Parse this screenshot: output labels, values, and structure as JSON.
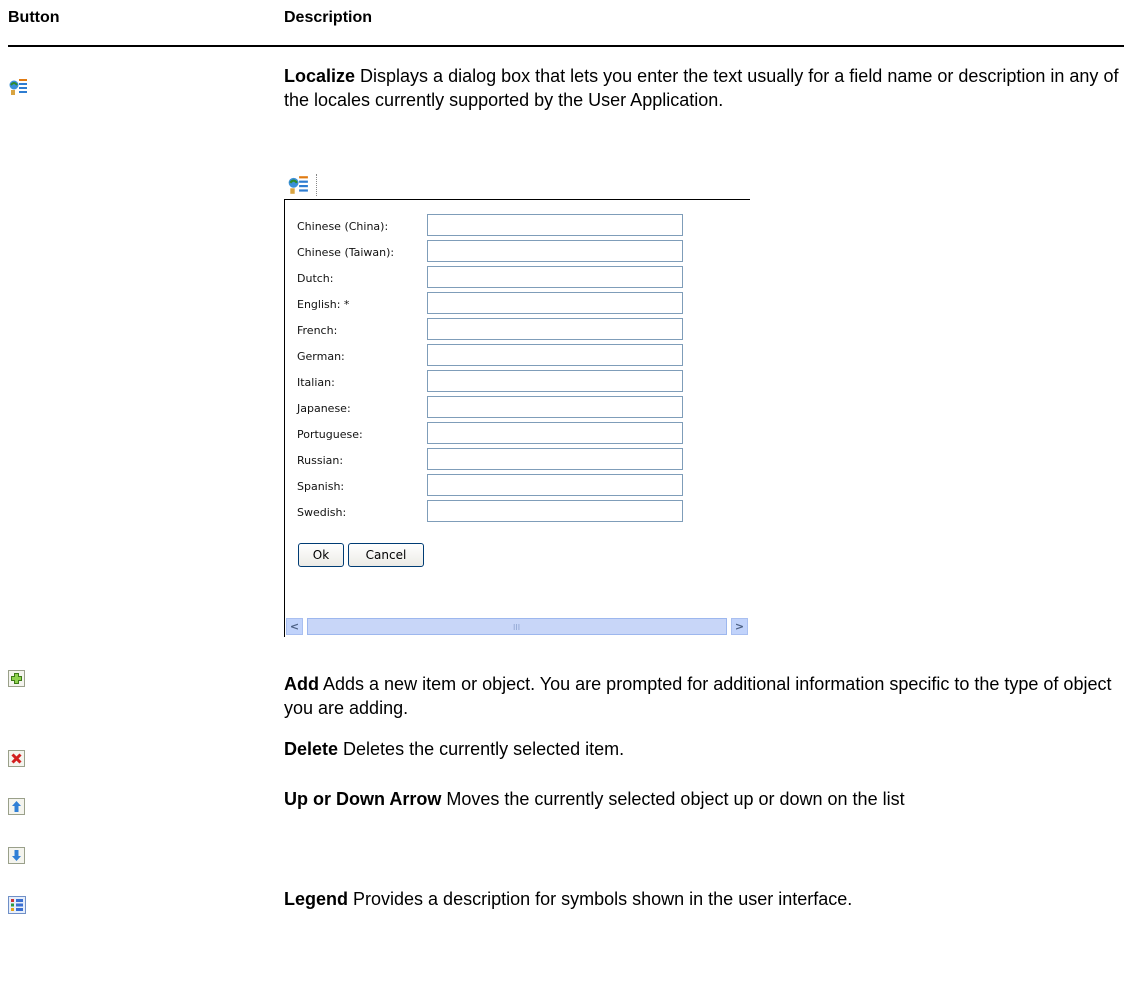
{
  "header": {
    "col1": "Button",
    "col2": "Description"
  },
  "rows": [
    {
      "icon": "localize-icon",
      "title": "Localize",
      "text": " Displays a dialog box that lets you enter the text usually for a field name or description in any of the locales currently supported by the User Application."
    },
    {
      "icon": "add-icon",
      "title": "Add",
      "text": " Adds a new item or object. You are prompted for additional information specific to the type of object you are adding."
    },
    {
      "icon": "delete-icon",
      "title": "Delete",
      "text": " Deletes the currently selected item."
    },
    {
      "icon": "up-arrow-icon",
      "title": "Up or Down Arrow",
      "text": " Moves the currently selected object up or down on the list"
    },
    {
      "icon": "down-arrow-icon"
    },
    {
      "icon": "legend-icon",
      "title": "Legend",
      "text": " Provides a description for symbols shown in the user interface."
    }
  ],
  "dialog": {
    "locales": [
      "Chinese (China):",
      "Chinese (Taiwan):",
      "Dutch:",
      "English: *",
      "French:",
      "German:",
      "Italian:",
      "Japanese:",
      "Portuguese:",
      "Russian:",
      "Spanish:",
      "Swedish:"
    ],
    "ok_label": "Ok",
    "cancel_label": "Cancel",
    "scroll_left": "<",
    "scroll_right": ">",
    "scroll_grip": "III"
  }
}
